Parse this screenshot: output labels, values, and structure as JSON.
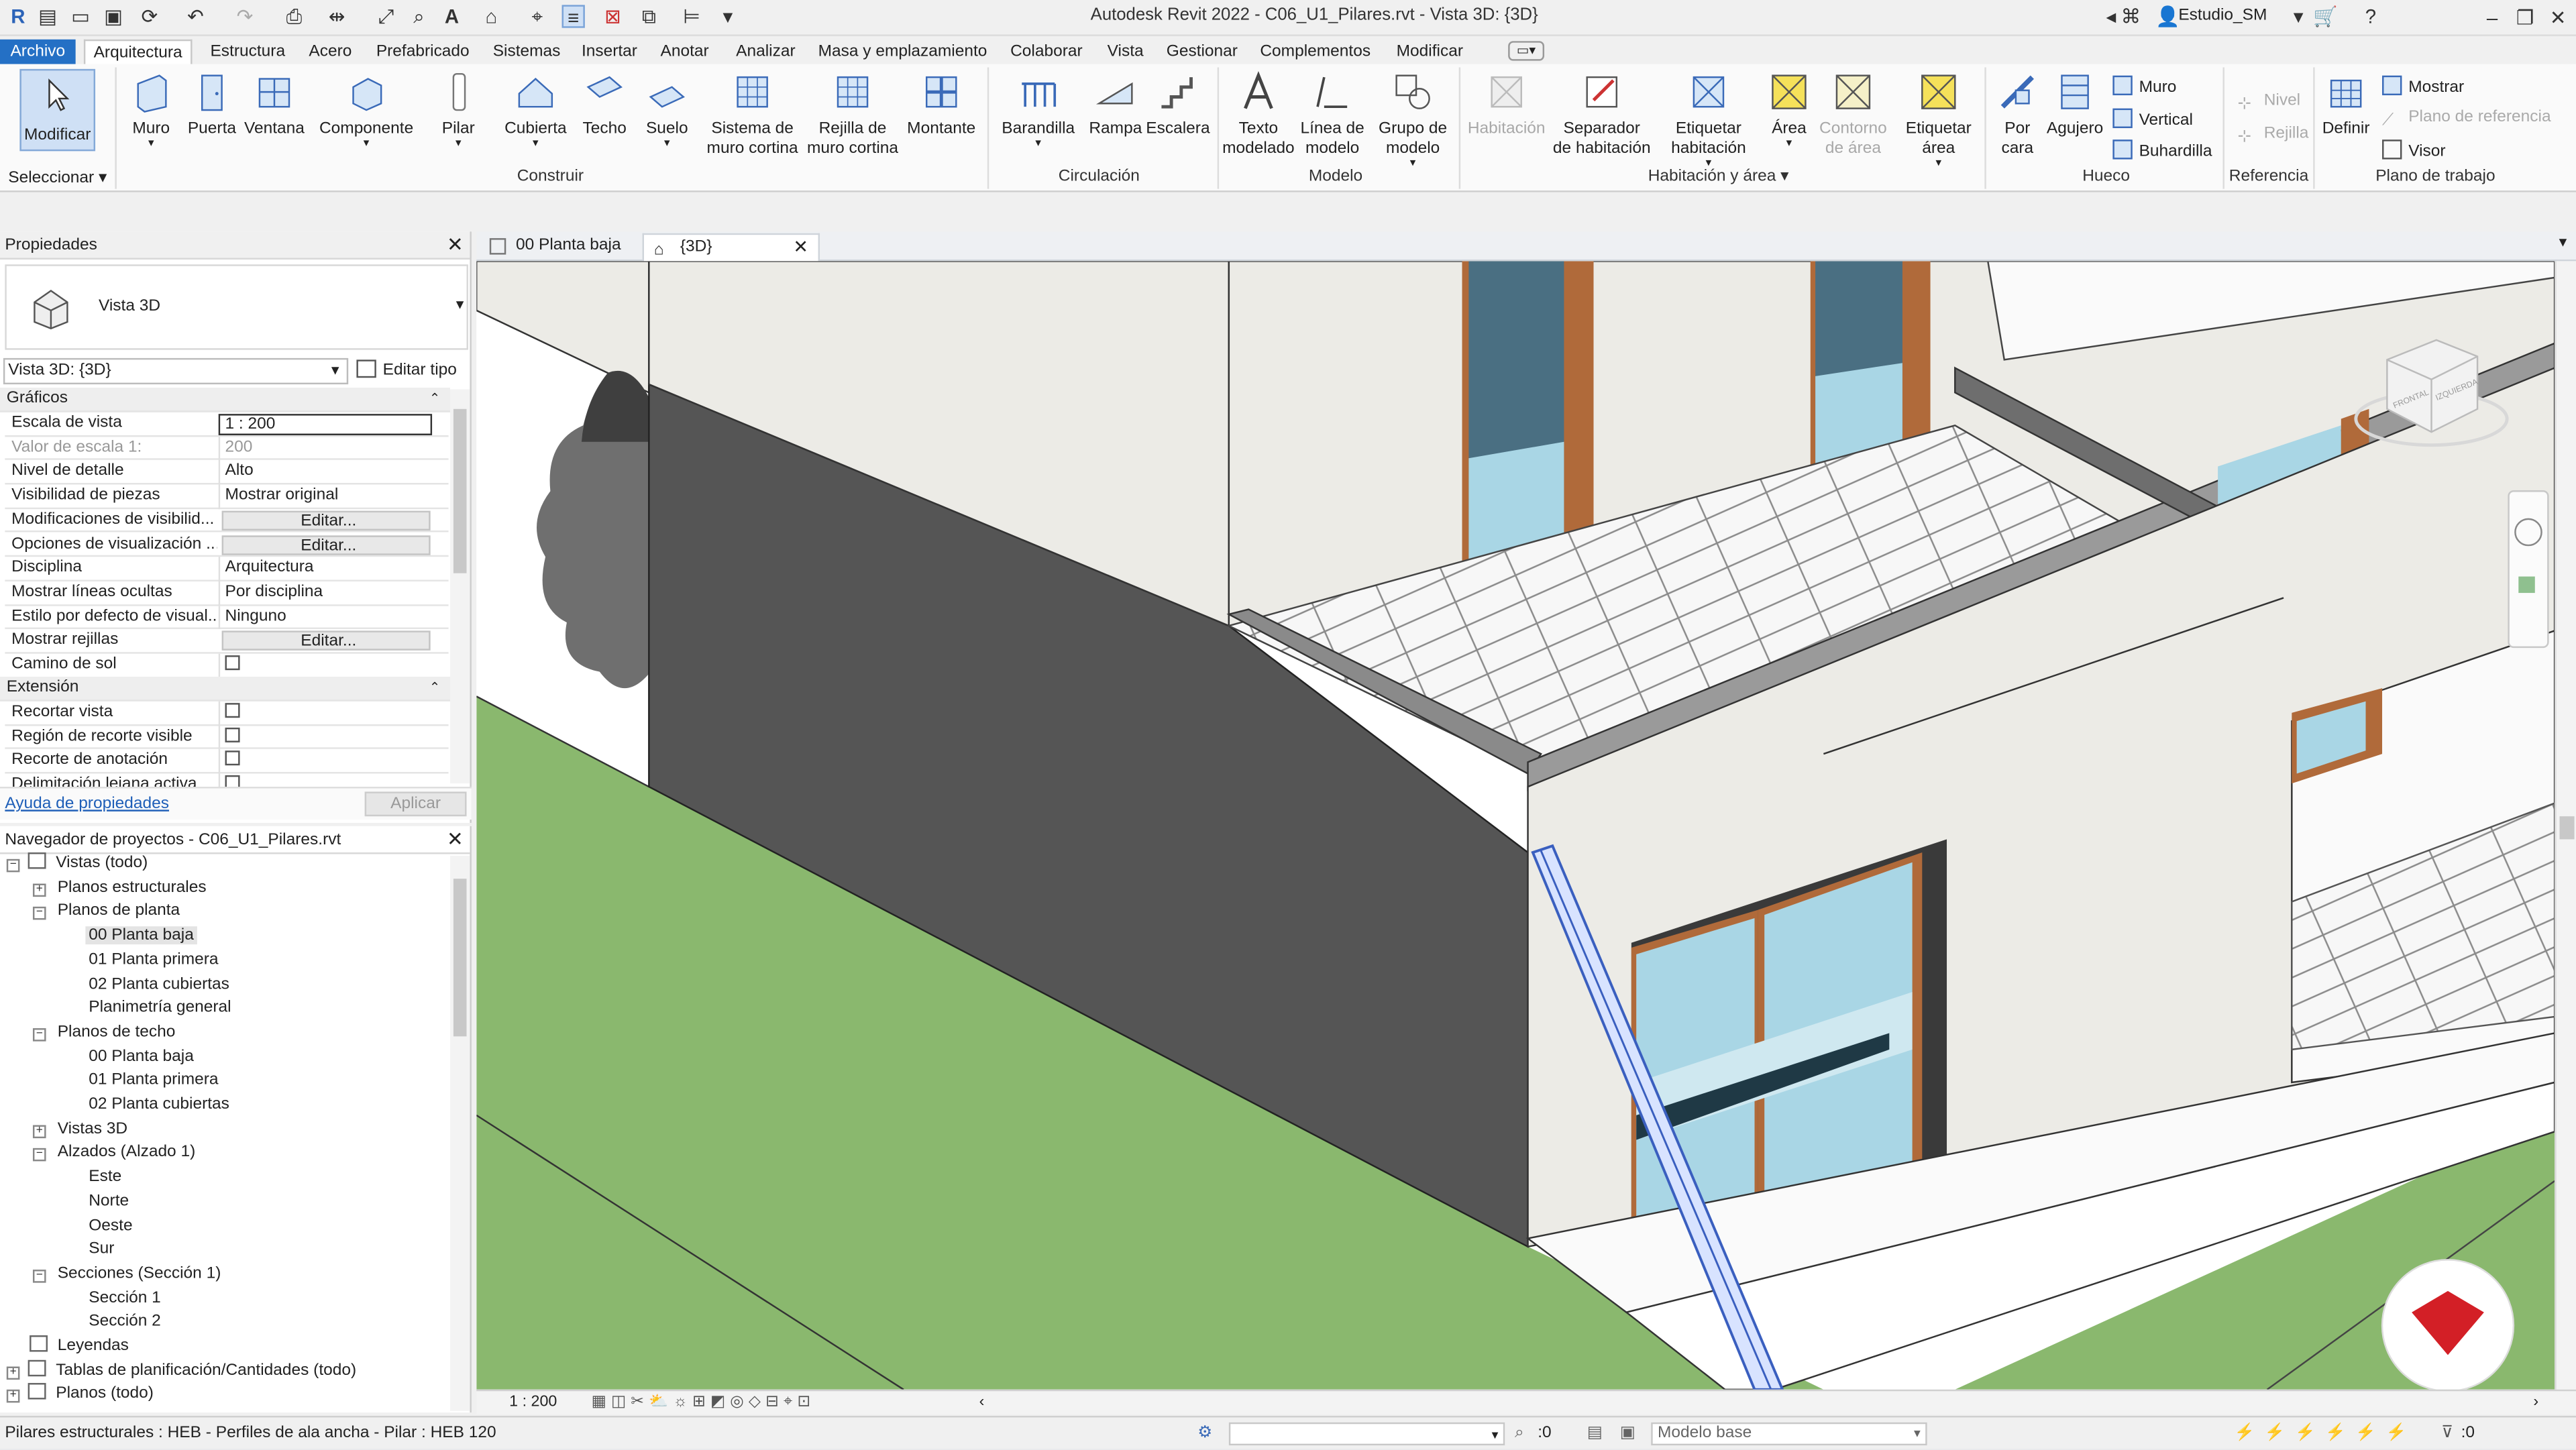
{
  "app": {
    "title": "Autodesk Revit 2022 - C06_U1_Pilares.rvt - Vista 3D: {3D}",
    "user": "Estudio_SM"
  },
  "menu": {
    "file": "Archivo",
    "tabs": [
      "Arquitectura",
      "Estructura",
      "Acero",
      "Prefabricado",
      "Sistemas",
      "Insertar",
      "Anotar",
      "Analizar",
      "Masa y emplazamiento",
      "Colaborar",
      "Vista",
      "Gestionar",
      "Complementos",
      "Modificar"
    ],
    "active": "Arquitectura"
  },
  "ribbon": {
    "select_label": "Seleccionar",
    "modify": "Modificar",
    "build": {
      "group": "Construir",
      "buttons": [
        "Muro",
        "Puerta",
        "Ventana",
        "Componente",
        "Pilar",
        "Cubierta",
        "Techo",
        "Suelo",
        "Sistema de\nmuro cortina",
        "Rejilla de\nmuro cortina",
        "Montante"
      ]
    },
    "circulation": {
      "group": "Circulación",
      "buttons": [
        "Barandilla",
        "Rampa",
        "Escalera"
      ]
    },
    "model": {
      "group": "Modelo",
      "buttons": [
        "Texto\nmodelado",
        "Línea de\nmodelo",
        "Grupo de\nmodelo"
      ]
    },
    "room": {
      "group": "Habitación y área",
      "buttons": [
        "Habitación",
        "Separador\nde habitación",
        "Etiquetar\nhabitación",
        "Área",
        "Contorno\nde área",
        "Etiquetar\nárea"
      ]
    },
    "opening": {
      "group": "Hueco",
      "buttons": [
        "Por\ncara",
        "Agujero"
      ],
      "small": [
        "Muro",
        "Vertical",
        "Buhardilla"
      ]
    },
    "datum": {
      "group": "Referencia",
      "small": [
        "Nivel",
        "Rejilla"
      ]
    },
    "workplane": {
      "group": "Plano de trabajo",
      "define": "Definir",
      "small": [
        "Mostrar",
        "Plano de referencia",
        "Visor"
      ]
    }
  },
  "properties": {
    "title": "Propiedades",
    "type_name": "Vista 3D",
    "instance_selector": "Vista 3D: {3D}",
    "edit_type": "Editar tipo",
    "groups": {
      "graphics": "Gráficos",
      "extents": "Extensión"
    },
    "rows": [
      {
        "k": "Escala de vista",
        "v": "1 : 200",
        "kind": "input"
      },
      {
        "k": "Valor de escala    1:",
        "v": "200",
        "kind": "dim"
      },
      {
        "k": "Nivel de detalle",
        "v": "Alto",
        "kind": "text"
      },
      {
        "k": "Visibilidad de piezas",
        "v": "Mostrar original",
        "kind": "text"
      },
      {
        "k": "Modificaciones de visibilid...",
        "v": "Editar...",
        "kind": "button"
      },
      {
        "k": "Opciones de visualización ...",
        "v": "Editar...",
        "kind": "button"
      },
      {
        "k": "Disciplina",
        "v": "Arquitectura",
        "kind": "text"
      },
      {
        "k": "Mostrar líneas ocultas",
        "v": "Por disciplina",
        "kind": "text"
      },
      {
        "k": "Estilo por defecto de visual...",
        "v": "Ninguno",
        "kind": "text"
      },
      {
        "k": "Mostrar rejillas",
        "v": "Editar...",
        "kind": "button"
      },
      {
        "k": "Camino de sol",
        "v": "",
        "kind": "check"
      }
    ],
    "rows2": [
      {
        "k": "Recortar vista",
        "v": "",
        "kind": "check"
      },
      {
        "k": "Región de recorte visible",
        "v": "",
        "kind": "check"
      },
      {
        "k": "Recorte de anotación",
        "v": "",
        "kind": "check"
      },
      {
        "k": "Delimitación lejana activa",
        "v": "",
        "kind": "check"
      }
    ],
    "help_link": "Ayuda de propiedades",
    "apply": "Aplicar"
  },
  "browser": {
    "title": "Navegador de proyectos - C06_U1_Pilares.rvt",
    "nodes": [
      {
        "t": "Vistas (todo)",
        "lvl": 0,
        "exp": "-",
        "icon": true
      },
      {
        "t": "Planos estructurales",
        "lvl": 1,
        "exp": "+"
      },
      {
        "t": "Planos de planta",
        "lvl": 1,
        "exp": "-"
      },
      {
        "t": "00 Planta baja",
        "lvl": 2,
        "sel": true
      },
      {
        "t": "01 Planta primera",
        "lvl": 2
      },
      {
        "t": "02 Planta cubiertas",
        "lvl": 2
      },
      {
        "t": "Planimetría general",
        "lvl": 2
      },
      {
        "t": "Planos de techo",
        "lvl": 1,
        "exp": "-"
      },
      {
        "t": "00 Planta baja",
        "lvl": 2
      },
      {
        "t": "01 Planta primera",
        "lvl": 2
      },
      {
        "t": "02 Planta cubiertas",
        "lvl": 2
      },
      {
        "t": "Vistas 3D",
        "lvl": 1,
        "exp": "+"
      },
      {
        "t": "Alzados (Alzado 1)",
        "lvl": 1,
        "exp": "-"
      },
      {
        "t": "Este",
        "lvl": 2
      },
      {
        "t": "Norte",
        "lvl": 2
      },
      {
        "t": "Oeste",
        "lvl": 2
      },
      {
        "t": "Sur",
        "lvl": 2
      },
      {
        "t": "Secciones (Sección 1)",
        "lvl": 1,
        "exp": "-"
      },
      {
        "t": "Sección 1",
        "lvl": 2
      },
      {
        "t": "Sección 2",
        "lvl": 2
      },
      {
        "t": "Leyendas",
        "lvl": 0,
        "icon": true
      },
      {
        "t": "Tablas de planificación/Cantidades (todo)",
        "lvl": 0,
        "exp": "+",
        "icon": true
      },
      {
        "t": "Planos (todo)",
        "lvl": 0,
        "exp": "+",
        "icon": true
      }
    ]
  },
  "views": {
    "tabs": [
      {
        "label": "00 Planta baja"
      },
      {
        "label": "{3D}"
      }
    ],
    "active": 1,
    "scale": "1 : 200",
    "viewcube": {
      "face1": "FRONTAL",
      "face2": "IZQUIERDA"
    }
  },
  "status": {
    "message": "Pilares estructurales : HEB - Perfiles de ala ancha - Pilar : HEB 120",
    "count": ":0",
    "model": "Modelo base",
    "filter": ":0"
  },
  "colors": {
    "accent": "#2470c5",
    "grass": "#8ab86e",
    "wall_dark": "#555555",
    "wall_light": "#ecebe6",
    "glass": "#a9d6e5",
    "frame": "#b06a3a",
    "column": "#3a5fbf"
  }
}
